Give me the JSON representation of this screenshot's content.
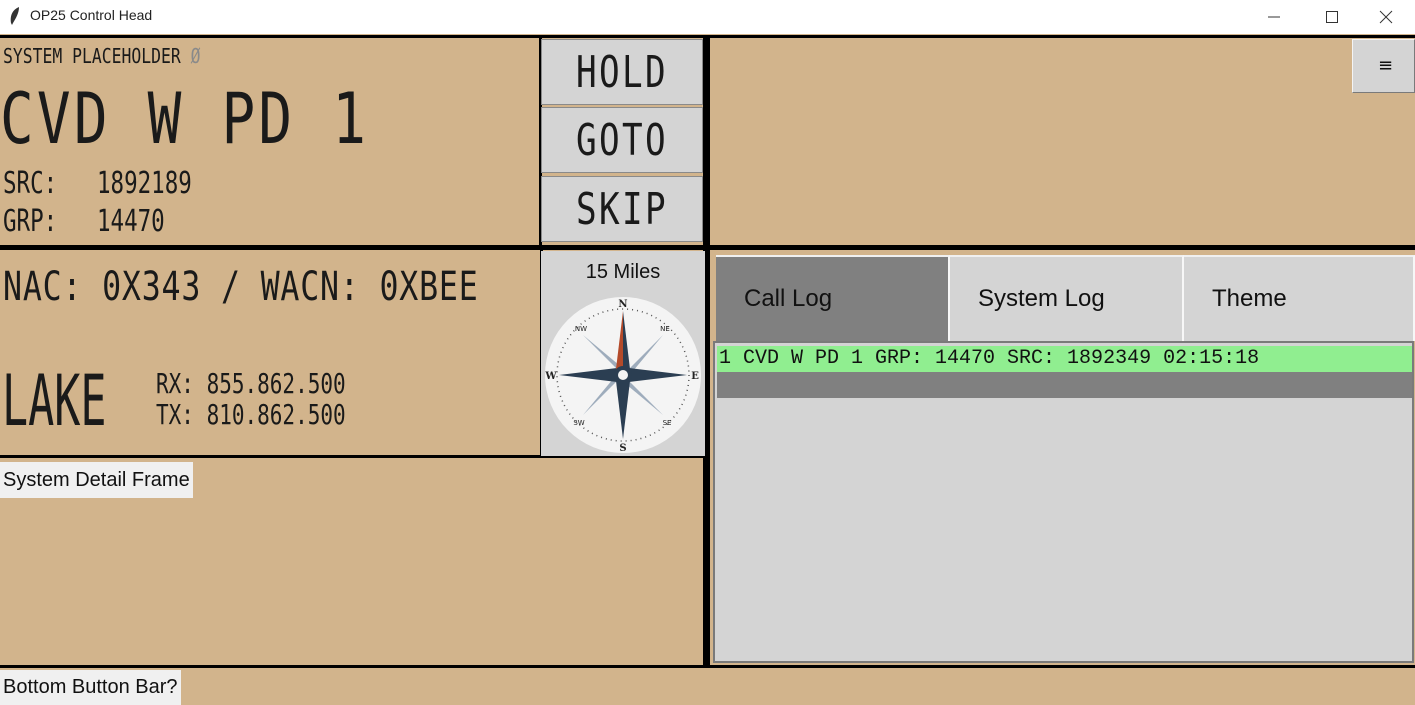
{
  "window": {
    "title": "OP25 Control Head"
  },
  "system": {
    "name": "SYSTEM PLACEHOLDER",
    "status_symbol": "Ø",
    "talkgroup": "CVD W PD 1",
    "src_label": "SRC:",
    "src_value": "1892189",
    "grp_label": "GRP:",
    "grp_value": "14470"
  },
  "controls": {
    "hold": "HOLD",
    "goto": "GOTO",
    "skip": "SKIP"
  },
  "site": {
    "nac_wacn": "NAC: 0X343 / WACN: 0XBEE",
    "site_name": "LAKE",
    "rx": "RX: 855.862.500",
    "tx": "TX: 810.862.500"
  },
  "compass": {
    "distance": "15 Miles",
    "labels": [
      "N",
      "NE",
      "E",
      "SE",
      "S",
      "SW",
      "W",
      "NW"
    ]
  },
  "frames": {
    "system_detail": "System Detail Frame",
    "bottom_bar": "Bottom Button Bar?"
  },
  "tabs": [
    {
      "label": "Call Log",
      "active": true
    },
    {
      "label": "System Log",
      "active": false
    },
    {
      "label": "Theme",
      "active": false
    }
  ],
  "call_log": [
    "1 CVD W PD 1 GRP: 14470 SRC: 1892349 02:15:18"
  ],
  "menu_icon": "hamburger-icon",
  "colors": {
    "background": "#d2b48c",
    "button": "#d4d4d4",
    "active_tab": "#808080",
    "log_highlight": "#90ee90"
  }
}
